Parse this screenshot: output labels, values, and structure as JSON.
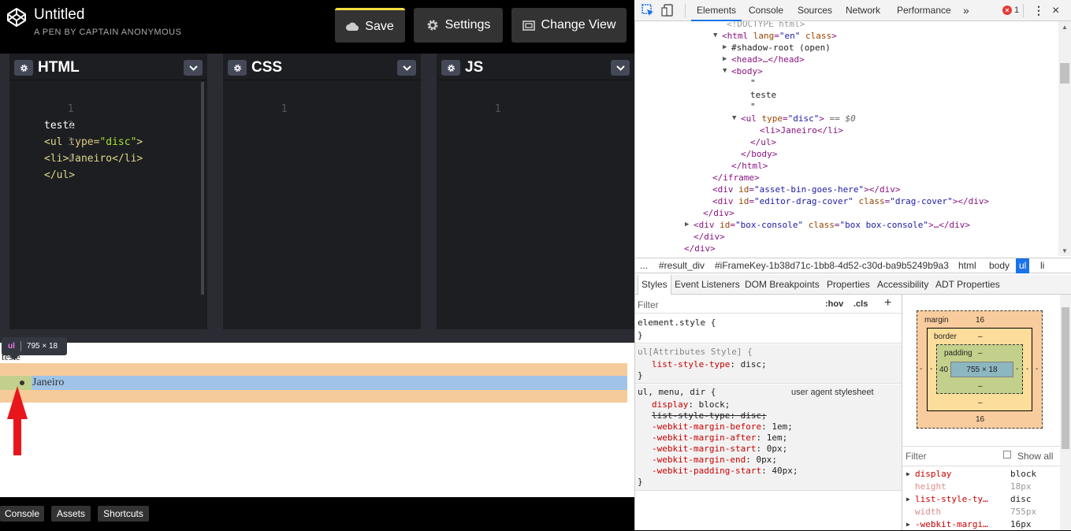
{
  "codepen": {
    "title": "Untitled",
    "subtitle": "A PEN BY CAPTAIN ANONYMOUS",
    "buttons": {
      "save": "Save",
      "settings": "Settings",
      "change_view": "Change View"
    },
    "editors": [
      {
        "name": "HTML",
        "lines": [
          {
            "num": "1",
            "text": "teste"
          },
          {
            "num": "2",
            "open": "<ul ",
            "attr": "type=",
            "str": "\"disc\"",
            "close": ">"
          },
          {
            "num": "3",
            "text": "<li>Janeiro</li>"
          },
          {
            "num": "4",
            "text": "</ul>"
          }
        ]
      },
      {
        "name": "CSS",
        "lines": [
          {
            "num": "1",
            "text": ""
          }
        ]
      },
      {
        "name": "JS",
        "lines": [
          {
            "num": "1",
            "text": ""
          }
        ]
      }
    ],
    "result": {
      "text_teste": "teste",
      "li_text": "Janeiro"
    },
    "tooltip": {
      "tag": "ul",
      "size": "795 × 18"
    },
    "footer": {
      "console": "Console",
      "assets": "Assets",
      "shortcuts": "Shortcuts"
    },
    "colors": {
      "save_accent": "#ffdd40",
      "margin_highlight": "#f6cb9a",
      "content_highlight": "#9fc4e7",
      "arrow": "#e8161b"
    }
  },
  "devtools": {
    "tabs": [
      "Elements",
      "Console",
      "Sources",
      "Network",
      "Performance"
    ],
    "more_tabs": "»",
    "error_count": "1",
    "dom": [
      {
        "indent": 116,
        "content": "<!DOCTYPE html>"
      },
      {
        "indent": 110,
        "arrow": "▼",
        "content": "<html lang=\"en\" class>"
      },
      {
        "indent": 122,
        "arrow": "▶",
        "content": "#shadow-root (open)"
      },
      {
        "indent": 122,
        "arrow": "▶",
        "content": "<head>…</head>"
      },
      {
        "indent": 122,
        "arrow": "▼",
        "content": "<body>"
      },
      {
        "indent": 146,
        "content": "\""
      },
      {
        "indent": 146,
        "content": "teste"
      },
      {
        "indent": 146,
        "content": "\""
      },
      {
        "indent": 134,
        "arrow": "▼",
        "content": "<ul type=\"disc\"> == $0"
      },
      {
        "indent": 158,
        "content": "<li>Janeiro</li>"
      },
      {
        "indent": 146,
        "content": "</ul>"
      },
      {
        "indent": 134,
        "content": "</body>"
      },
      {
        "indent": 122,
        "content": "</html>"
      },
      {
        "indent": 98,
        "content": "</iframe>"
      },
      {
        "indent": 98,
        "content": "<div id=\"asset-bin-goes-here\"></div>"
      },
      {
        "indent": 98,
        "content": "<div id=\"editor-drag-cover\" class=\"drag-cover\"></div>"
      },
      {
        "indent": 86,
        "content": "</div>"
      },
      {
        "indent": 74,
        "arrow": "▶",
        "content": "<div id=\"box-console\" class=\"box box-console\">…</div>"
      },
      {
        "indent": 74,
        "content": "</div>"
      },
      {
        "indent": 62,
        "content": "</div>"
      },
      {
        "indent": 50,
        "content": "</div>"
      }
    ],
    "breadcrumbs": [
      "...",
      "#result_div",
      "#iFrameKey-1b38d71c-1bb8-4d52-c30d-ba9b5249b9a3",
      "html",
      "body",
      "ul",
      "li"
    ],
    "subtabs": [
      "Styles",
      "Event Listeners",
      "DOM Breakpoints",
      "Properties",
      "Accessibility",
      "ADT Properties"
    ],
    "styles": {
      "filter_placeholder": "Filter",
      "hov": ":hov",
      "cls": ".cls",
      "plus": "+",
      "rules": [
        {
          "selector": "element.style {",
          "props": [],
          "end": "}"
        },
        {
          "selector": "ul[Attributes Style] {",
          "props": [
            {
              "name": "list-style-type",
              "value": "disc;"
            }
          ],
          "end": "}"
        },
        {
          "selector": "ul, menu, dir {",
          "source": "user agent stylesheet",
          "props": [
            {
              "name": "display",
              "value": "block;"
            },
            {
              "name": "list-style-type",
              "value": "disc;",
              "struck": true
            },
            {
              "name": "-webkit-margin-before",
              "value": "1em;"
            },
            {
              "name": "-webkit-margin-after",
              "value": "1em;"
            },
            {
              "name": "-webkit-margin-start",
              "value": "0px;"
            },
            {
              "name": "-webkit-margin-end",
              "value": "0px;"
            },
            {
              "name": "-webkit-padding-start",
              "value": "40px;"
            }
          ],
          "end": "}"
        }
      ]
    },
    "box_model": {
      "margin_label": "margin",
      "margin_top": "16",
      "margin_bottom": "16",
      "margin_left": "-",
      "margin_right": "-",
      "border_label": "border",
      "border_top": "–",
      "border_bottom": "–",
      "border_left": "-",
      "border_right": "-",
      "padding_label": "padding",
      "padding_top": "–",
      "padding_bottom": "–",
      "padding_left": "40",
      "padding_right": "-",
      "content": "755 × 18"
    },
    "computed": {
      "filter_placeholder": "Filter",
      "show_all": "Show all",
      "rows": [
        {
          "name": "display",
          "value": "block",
          "expandable": true,
          "dim": false
        },
        {
          "name": "height",
          "value": "18px",
          "expandable": false,
          "dim": true
        },
        {
          "name": "list-style-ty…",
          "value": "disc",
          "expandable": true,
          "dim": false
        },
        {
          "name": "width",
          "value": "755px",
          "expandable": false,
          "dim": true
        },
        {
          "name": "-webkit-margi…",
          "value": "16px",
          "expandable": true,
          "dim": false
        }
      ]
    }
  }
}
